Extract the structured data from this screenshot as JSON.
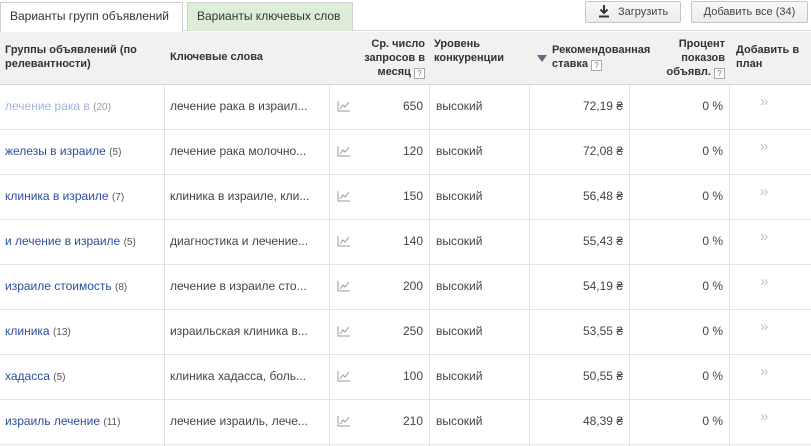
{
  "tabs": {
    "ad_groups": "Варианты групп объявлений",
    "keywords": "Варианты ключевых слов"
  },
  "buttons": {
    "upload": "Загрузить",
    "add_all": "Добавить все (34)"
  },
  "columns": {
    "group_l1": "Группы объявлений (по",
    "group_l2": "релевантности)",
    "keywords": "Ключевые слова",
    "volume_l1": "Ср. число",
    "volume_l2": "запросов в",
    "volume_l3": "месяц",
    "competition_l1": "Уровень",
    "competition_l2": "конкуренции",
    "bid_l1": "Рекомендованная",
    "bid_l2": "ставка",
    "share_l1": "Процент",
    "share_l2": "показов",
    "share_l3": "объявл.",
    "add_l1": "Добавить в",
    "add_l2": "план",
    "help_glyph": "?"
  },
  "rows": [
    {
      "group": "лечение рака в",
      "count": "(20)",
      "keywords": "лечение рака в израил...",
      "volume": "650",
      "competition": "высокий",
      "bid": "72,19 ₴",
      "share": "0 %",
      "add": "»"
    },
    {
      "group": "железы в израиле",
      "count": "(5)",
      "keywords": "лечение рака молочно...",
      "volume": "120",
      "competition": "высокий",
      "bid": "72,08 ₴",
      "share": "0 %",
      "add": "»"
    },
    {
      "group": "клиника в израиле",
      "count": "(7)",
      "keywords": "клиника в израиле, кли...",
      "volume": "150",
      "competition": "высокий",
      "bid": "56,48 ₴",
      "share": "0 %",
      "add": "»"
    },
    {
      "group": "и лечение в израиле",
      "count": "(5)",
      "keywords": "диагностика и лечение...",
      "volume": "140",
      "competition": "высокий",
      "bid": "55,43 ₴",
      "share": "0 %",
      "add": "»"
    },
    {
      "group": "израиле стоимость",
      "count": "(8)",
      "keywords": "лечение в израиле сто...",
      "volume": "200",
      "competition": "высокий",
      "bid": "54,19 ₴",
      "share": "0 %",
      "add": "»"
    },
    {
      "group": "клиника",
      "count": "(13)",
      "keywords": "израильская клиника в...",
      "volume": "250",
      "competition": "высокий",
      "bid": "53,55 ₴",
      "share": "0 %",
      "add": "»"
    },
    {
      "group": "хадасса",
      "count": "(5)",
      "keywords": "клиника хадасса, боль...",
      "volume": "100",
      "competition": "высокий",
      "bid": "50,55 ₴",
      "share": "0 %",
      "add": "»"
    },
    {
      "group": "израиль лечение",
      "count": "(11)",
      "keywords": "лечение израиль, лече...",
      "volume": "210",
      "competition": "высокий",
      "bid": "48,39 ₴",
      "share": "0 %",
      "add": "»"
    }
  ],
  "icons": {
    "download": "download-icon",
    "trend": "trend-chart-icon",
    "add": "double-chevron-right-icon",
    "sort": "sort-desc-arrow-icon"
  },
  "colors": {
    "link": "#2b4e9c",
    "link_faded": "#9fb6d8",
    "inactive_tab": "#deedd8",
    "header_bg": "#f1f1f1"
  }
}
